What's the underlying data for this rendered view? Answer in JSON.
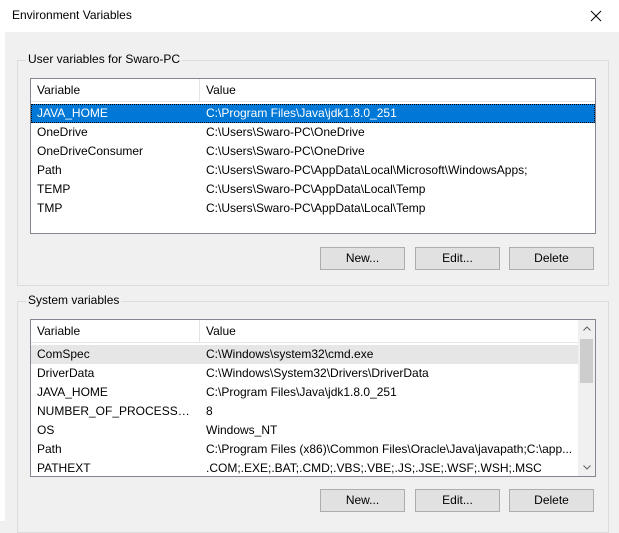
{
  "window": {
    "title": "Environment Variables"
  },
  "user_vars": {
    "group_label": "User variables for Swaro-PC",
    "columns": {
      "variable": "Variable",
      "value": "Value"
    },
    "rows": [
      {
        "variable": "JAVA_HOME",
        "value": "C:\\Program Files\\Java\\jdk1.8.0_251"
      },
      {
        "variable": "OneDrive",
        "value": "C:\\Users\\Swaro-PC\\OneDrive"
      },
      {
        "variable": "OneDriveConsumer",
        "value": "C:\\Users\\Swaro-PC\\OneDrive"
      },
      {
        "variable": "Path",
        "value": "C:\\Users\\Swaro-PC\\AppData\\Local\\Microsoft\\WindowsApps;"
      },
      {
        "variable": "TEMP",
        "value": "C:\\Users\\Swaro-PC\\AppData\\Local\\Temp"
      },
      {
        "variable": "TMP",
        "value": "C:\\Users\\Swaro-PC\\AppData\\Local\\Temp"
      }
    ],
    "buttons": {
      "new": "New...",
      "edit": "Edit...",
      "delete": "Delete"
    }
  },
  "system_vars": {
    "group_label": "System variables",
    "columns": {
      "variable": "Variable",
      "value": "Value"
    },
    "rows": [
      {
        "variable": "ComSpec",
        "value": "C:\\Windows\\system32\\cmd.exe"
      },
      {
        "variable": "DriverData",
        "value": "C:\\Windows\\System32\\Drivers\\DriverData"
      },
      {
        "variable": "JAVA_HOME",
        "value": "C:\\Program Files\\Java\\jdk1.8.0_251"
      },
      {
        "variable": "NUMBER_OF_PROCESSORS",
        "value": "8"
      },
      {
        "variable": "OS",
        "value": "Windows_NT"
      },
      {
        "variable": "Path",
        "value": "C:\\Program Files (x86)\\Common Files\\Oracle\\Java\\javapath;C:\\app..."
      },
      {
        "variable": "PATHEXT",
        "value": ".COM;.EXE;.BAT;.CMD;.VBS;.VBE;.JS;.JSE;.WSF;.WSH;.MSC"
      }
    ],
    "buttons": {
      "new": "New...",
      "edit": "Edit...",
      "delete": "Delete"
    }
  },
  "colors": {
    "selection": "#0078d7",
    "background": "#f0f0f0",
    "button": "#e1e1e1"
  },
  "icons": {
    "close": "close-icon",
    "scroll_up": "chevron-up-icon",
    "scroll_down": "chevron-down-icon"
  }
}
